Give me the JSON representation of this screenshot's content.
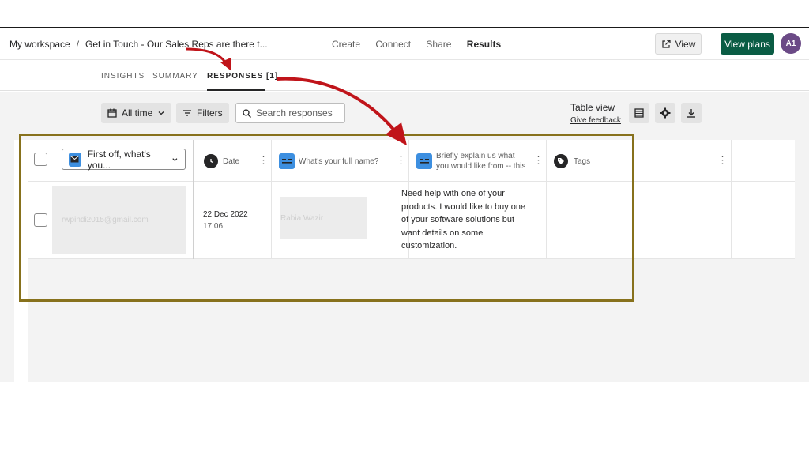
{
  "breadcrumb": {
    "workspace": "My workspace",
    "separator": "/",
    "form_title": "Get in Touch - Our Sales Reps are there t..."
  },
  "nav": {
    "create": "Create",
    "connect": "Connect",
    "share": "Share",
    "results": "Results"
  },
  "header_actions": {
    "view_label": "View",
    "plans_label": "View plans",
    "avatar_initials": "A1"
  },
  "tabs": {
    "insights": "INSIGHTS",
    "summary": "SUMMARY",
    "responses": "RESPONSES [1]"
  },
  "toolbar": {
    "time_filter": "All time",
    "filters": "Filters",
    "search_placeholder": "Search responses",
    "table_view": "Table view",
    "give_feedback": "Give feedback"
  },
  "table": {
    "email_column": "First off, what's you...",
    "columns": {
      "date": "Date",
      "full_name": "What's your full name?",
      "explain": "Briefly explain us what you would like from -- this wil...",
      "tags": "Tags"
    },
    "row": {
      "email": "rwpindi2015@gmail.com",
      "date": "22 Dec 2022",
      "time": "17:06",
      "name": "Rabia Wazir",
      "message": "Need help with one of your products. I would like to buy one of your software solutions but want details on some customization."
    }
  },
  "colors": {
    "accent_green": "#0a5c44",
    "question_blue": "#3d8fe0",
    "highlight_border": "#87711c",
    "annotation_arrow": "#c0141a"
  }
}
